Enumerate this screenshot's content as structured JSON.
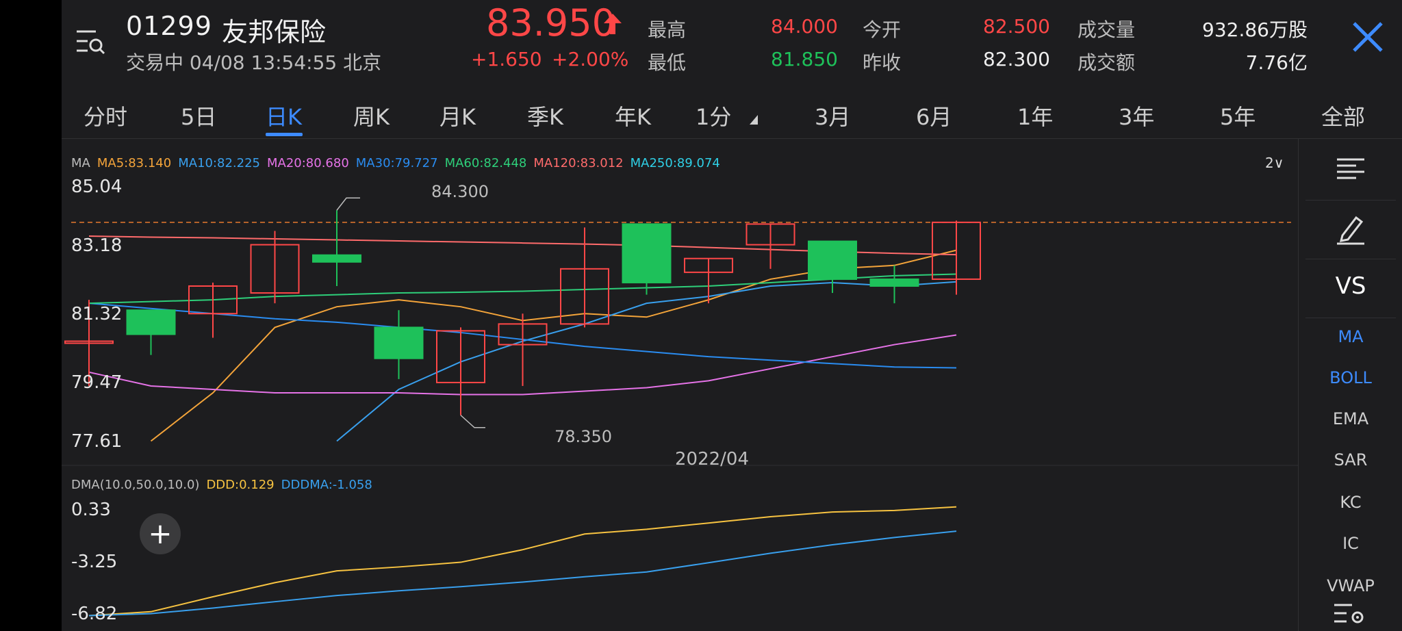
{
  "stock": {
    "code": "01299",
    "name": "友邦保险",
    "status": "交易中 04/08 13:54:55 北京",
    "price": "83.950",
    "change": "+1.650",
    "change_pct": "+2.00%"
  },
  "quote": {
    "high_label": "最高",
    "high": "84.000",
    "low_label": "最低",
    "low": "81.850",
    "open_label": "今开",
    "open": "82.500",
    "prev_close_label": "昨收",
    "prev_close": "82.300",
    "volume_label": "成交量",
    "volume": "932.86万股",
    "turnover_label": "成交额",
    "turnover": "7.76亿"
  },
  "periods": [
    "分时",
    "5日",
    "日K",
    "周K",
    "月K",
    "季K",
    "年K",
    "1分",
    "3月",
    "6月",
    "1年",
    "3年",
    "5年",
    "全部"
  ],
  "active_period": "日K",
  "ma_legend": {
    "prefix": "MA",
    "ma5": "MA5:83.140",
    "ma10": "MA10:82.225",
    "ma20": "MA20:80.680",
    "ma30": "MA30:79.727",
    "ma60": "MA60:82.448",
    "ma120": "MA120:83.012",
    "ma250": "MA250:89.074",
    "more": "2∨"
  },
  "price_axis": [
    "85.04",
    "83.18",
    "81.32",
    "79.47",
    "77.61"
  ],
  "annotations": {
    "max": "84.300",
    "min": "78.350"
  },
  "date_label": "2022/04",
  "dma_legend": {
    "title": "DMA(10.0,50.0,10.0)",
    "ddd": "DDD:0.129",
    "dddma": "DDDMA:-1.058"
  },
  "dma_axis": [
    "0.33",
    "-3.25",
    "-6.82"
  ],
  "plus_label": "+",
  "sidebar": {
    "items": [
      "VS",
      "MA",
      "BOLL",
      "EMA",
      "SAR",
      "KC",
      "IC",
      "VWAP"
    ]
  },
  "colors": {
    "up": "#ff4747",
    "down": "#1ec15a",
    "accent": "#3d8bff",
    "ma5": "#f4a43a",
    "ma10": "#39a0ee",
    "ma20": "#e673e8",
    "ma30": "#2a8cf0",
    "ma60": "#2ecf7a",
    "ma120": "#ff6b6b",
    "ma250": "#2fd0e6",
    "ddd": "#f7c341",
    "dddma": "#39a0ee"
  },
  "chart_data": {
    "type": "candlestick",
    "ylim": [
      77.61,
      85.04
    ],
    "candles": [
      {
        "open": 80.5,
        "close": 80.5,
        "high": 81.7,
        "low": 79.2
      },
      {
        "open": 81.4,
        "close": 80.7,
        "high": 81.4,
        "low": 80.1
      },
      {
        "open": 81.3,
        "close": 82.1,
        "high": 82.2,
        "low": 80.6
      },
      {
        "open": 81.9,
        "close": 83.3,
        "high": 83.7,
        "low": 81.6
      },
      {
        "open": 83.0,
        "close": 82.8,
        "high": 84.3,
        "low": 82.1
      },
      {
        "open": 80.9,
        "close": 80.0,
        "high": 81.4,
        "low": 79.4
      },
      {
        "open": 79.3,
        "close": 80.8,
        "high": 80.9,
        "low": 78.35
      },
      {
        "open": 80.4,
        "close": 81.0,
        "high": 81.3,
        "low": 79.2
      },
      {
        "open": 81.0,
        "close": 82.6,
        "high": 83.8,
        "low": 80.9
      },
      {
        "open": 83.9,
        "close": 82.2,
        "high": 83.9,
        "low": 81.85
      },
      {
        "open": 82.5,
        "close": 82.9,
        "high": 82.9,
        "low": 81.6
      },
      {
        "open": 83.3,
        "close": 83.9,
        "high": 83.9,
        "low": 82.6
      },
      {
        "open": 83.4,
        "close": 82.3,
        "high": 83.4,
        "low": 81.9
      },
      {
        "open": 82.3,
        "close": 82.1,
        "high": 82.7,
        "low": 81.6
      },
      {
        "open": 82.3,
        "close": 83.95,
        "high": 84.0,
        "low": 81.85
      }
    ],
    "ma_series": [
      {
        "key": "ma5",
        "values": [
          null,
          77.6,
          79.0,
          80.9,
          81.5,
          81.7,
          81.5,
          81.1,
          81.3,
          81.2,
          81.7,
          82.3,
          82.6,
          82.7,
          83.14
        ]
      },
      {
        "key": "ma10",
        "values": [
          null,
          null,
          null,
          null,
          77.6,
          79.1,
          79.9,
          80.5,
          81.0,
          81.6,
          81.8,
          82.1,
          82.2,
          82.1,
          82.225
        ]
      },
      {
        "key": "ma20",
        "values": [
          79.6,
          79.2,
          79.1,
          79.0,
          79.0,
          79.0,
          78.95,
          78.95,
          79.05,
          79.15,
          79.35,
          79.7,
          80.05,
          80.4,
          80.68
        ]
      },
      {
        "key": "ma30",
        "values": [
          81.6,
          81.45,
          81.3,
          81.15,
          81.05,
          80.9,
          80.75,
          80.55,
          80.35,
          80.2,
          80.05,
          79.95,
          79.85,
          79.75,
          79.727
        ]
      },
      {
        "key": "ma60",
        "values": [
          81.6,
          81.65,
          81.7,
          81.8,
          81.85,
          81.9,
          81.92,
          81.95,
          82.0,
          82.05,
          82.1,
          82.2,
          82.3,
          82.4,
          82.448
        ]
      },
      {
        "key": "ma120",
        "values": [
          83.55,
          83.52,
          83.5,
          83.47,
          83.44,
          83.41,
          83.38,
          83.35,
          83.32,
          83.28,
          83.22,
          83.16,
          83.1,
          83.05,
          83.012
        ]
      }
    ],
    "dma": {
      "ylim": [
        -6.82,
        0.33
      ],
      "ddd": [
        -6.8,
        -6.55,
        -5.6,
        -4.7,
        -3.95,
        -3.7,
        -3.4,
        -2.6,
        -1.6,
        -1.3,
        -0.9,
        -0.5,
        -0.2,
        -0.1,
        0.129
      ]
    }
  }
}
